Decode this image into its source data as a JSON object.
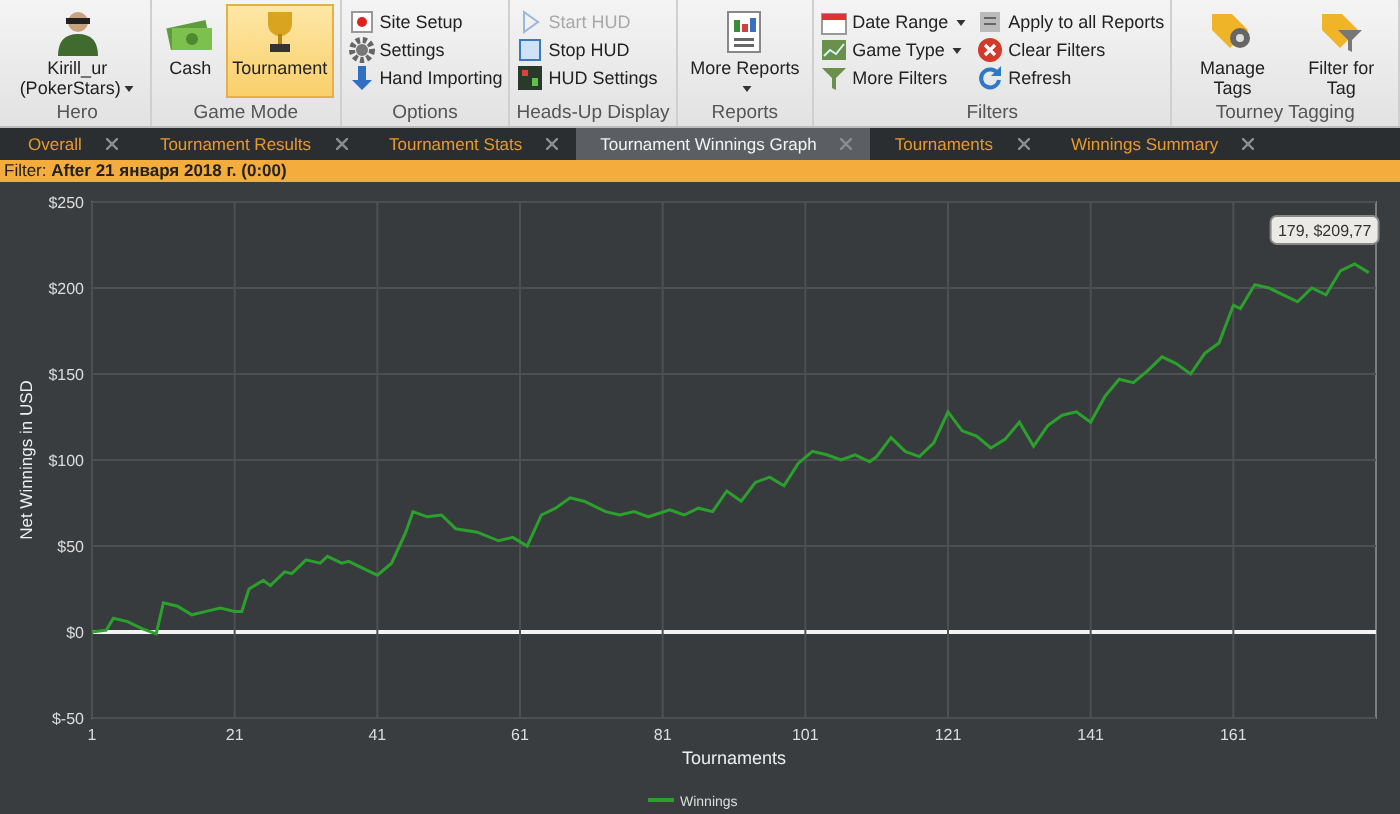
{
  "ribbon": {
    "groups": [
      {
        "label": "Hero",
        "items": [
          {
            "kind": "large",
            "label": "Kirill_ur (PokerStars)",
            "dropdown": true
          }
        ]
      },
      {
        "label": "Game Mode",
        "items": [
          {
            "kind": "large",
            "label": "Cash",
            "selected": false
          },
          {
            "kind": "large",
            "label": "Tournament",
            "selected": true
          }
        ]
      },
      {
        "label": "Options",
        "items": [
          {
            "kind": "small",
            "label": "Site Setup"
          },
          {
            "kind": "small",
            "label": "Settings"
          },
          {
            "kind": "small",
            "label": "Hand Importing"
          }
        ]
      },
      {
        "label": "Heads-Up Display",
        "items": [
          {
            "kind": "small",
            "label": "Start HUD",
            "disabled": true
          },
          {
            "kind": "small",
            "label": "Stop HUD",
            "disabled": false
          },
          {
            "kind": "small",
            "label": "HUD Settings",
            "disabled": false
          }
        ]
      },
      {
        "label": "Reports",
        "items": [
          {
            "kind": "large",
            "label": "More Reports",
            "dropdown": true
          }
        ]
      },
      {
        "label": "Filters",
        "items": [
          {
            "kind": "small",
            "label": "Date Range",
            "dropdown": true
          },
          {
            "kind": "small",
            "label": "Game Type",
            "dropdown": true
          },
          {
            "kind": "small",
            "label": "More Filters"
          },
          {
            "kind": "small",
            "label": "Apply to all Reports"
          },
          {
            "kind": "small",
            "label": "Clear Filters"
          },
          {
            "kind": "small",
            "label": "Refresh"
          }
        ]
      },
      {
        "label": "Tourney Tagging",
        "items": [
          {
            "kind": "large",
            "label": "Manage Tags"
          },
          {
            "kind": "large",
            "label": "Filter for Tag"
          }
        ]
      }
    ]
  },
  "tabs": [
    {
      "label": "Overall",
      "selected": false
    },
    {
      "label": "Tournament Results",
      "selected": false
    },
    {
      "label": "Tournament Stats",
      "selected": false
    },
    {
      "label": "Tournament Winnings Graph",
      "selected": true
    },
    {
      "label": "Tournaments",
      "selected": false
    },
    {
      "label": "Winnings Summary",
      "selected": false
    }
  ],
  "filter_bar": "Filter: **After 21 января 2018 г. (0:00)**",
  "chart": {
    "tooltip": "179, $209,77",
    "chart_data": {
      "type": "line",
      "grid": true,
      "xlabel": "Tournaments",
      "ylabel": "Net Winnings in USD",
      "xlim": [
        1,
        181
      ],
      "ylim": [
        -50,
        250
      ],
      "xticks": [
        1,
        21,
        41,
        61,
        81,
        101,
        121,
        141,
        161
      ],
      "yticks": [
        {
          "value": 250,
          "label": "$250"
        },
        {
          "value": 200,
          "label": "$200"
        },
        {
          "value": 150,
          "label": "$150"
        },
        {
          "value": 100,
          "label": "$100"
        },
        {
          "value": 50,
          "label": "$50"
        },
        {
          "value": 0,
          "label": "$0"
        },
        {
          "value": -50,
          "label": "$-50"
        }
      ],
      "x": [
        1,
        3,
        4,
        6,
        8,
        10,
        11,
        13,
        15,
        17,
        19,
        21,
        22,
        23,
        25,
        26,
        28,
        29,
        31,
        33,
        34,
        36,
        37,
        39,
        41,
        43,
        45,
        46,
        48,
        50,
        52,
        55,
        58,
        60,
        62,
        64,
        66,
        68,
        70,
        73,
        75,
        77,
        79,
        82,
        84,
        86,
        88,
        90,
        92,
        94,
        96,
        98,
        100,
        102,
        104,
        106,
        108,
        110,
        111,
        113,
        115,
        117,
        119,
        121,
        123,
        125,
        127,
        129,
        131,
        133,
        135,
        137,
        139,
        141,
        143,
        145,
        147,
        149,
        151,
        153,
        155,
        157,
        159,
        161,
        162,
        164,
        166,
        168,
        170,
        172,
        174,
        176,
        178,
        180
      ],
      "series": [
        {
          "name": "Winnings",
          "color": "#2ca02c",
          "values": [
            0,
            1,
            8,
            6,
            2,
            -1,
            17,
            15,
            10,
            12,
            14,
            12,
            12,
            25,
            30,
            27,
            35,
            34,
            42,
            40,
            44,
            40,
            41,
            37,
            33,
            40,
            58,
            70,
            67,
            68,
            60,
            58,
            53,
            55,
            50,
            68,
            72,
            78,
            76,
            70,
            68,
            70,
            67,
            71,
            68,
            72,
            70,
            82,
            76,
            87,
            90,
            85,
            98,
            105,
            103,
            100,
            103,
            99,
            102,
            113,
            105,
            102,
            110,
            128,
            117,
            114,
            107,
            112,
            122,
            108,
            120,
            126,
            128,
            122,
            137,
            147,
            145,
            152,
            160,
            156,
            150,
            162,
            168,
            190,
            188,
            202,
            200,
            196,
            192,
            200,
            196,
            210,
            214,
            209
          ]
        }
      ]
    }
  }
}
